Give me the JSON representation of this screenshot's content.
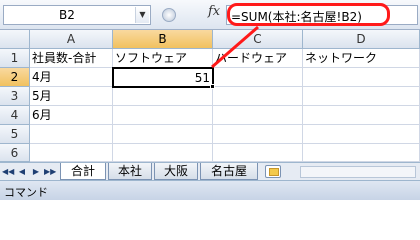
{
  "formula_bar": {
    "name_box": "B2",
    "fx_label": "fx",
    "formula": "=SUM(本社:名古屋!B2)"
  },
  "grid": {
    "columns": [
      "A",
      "B",
      "C",
      "D"
    ],
    "rows": [
      "1",
      "2",
      "3",
      "4",
      "5",
      "6"
    ],
    "cells": {
      "A1": "社員数-合計",
      "B1": "ソフトウェア",
      "C1": "ハードウェア",
      "D1": "ネットワーク",
      "A2": "4月",
      "B2": "51",
      "A3": "5月",
      "A4": "6月"
    },
    "selected_cell": "B2"
  },
  "sheet_tabs": {
    "nav_first": "◀◀",
    "nav_prev": "◀",
    "nav_next": "▶",
    "nav_last": "▶▶",
    "tabs": [
      "合計",
      "本社",
      "大阪",
      "名古屋"
    ],
    "active": "合計"
  },
  "status_bar": {
    "mode": "コマンド"
  },
  "colors": {
    "callout": "#ff1a1a",
    "active_header": "#f1c15f"
  }
}
